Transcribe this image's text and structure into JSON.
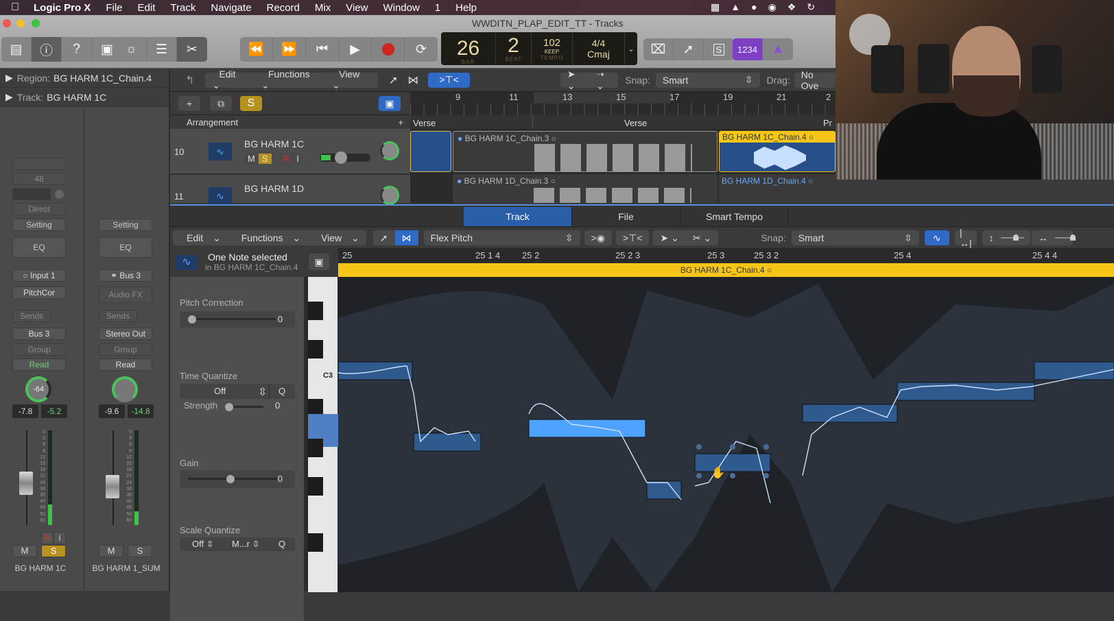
{
  "menubar": {
    "app": "Logic Pro X",
    "items": [
      "File",
      "Edit",
      "Track",
      "Navigate",
      "Record",
      "Mix",
      "View",
      "Window",
      "1",
      "Help"
    ]
  },
  "window": {
    "title": "WWDITN_PLAP_EDIT_TT - Tracks"
  },
  "lcd": {
    "bar": "26",
    "beat": "2",
    "bar_label": "BAR",
    "beat_label": "BEAT",
    "tempo": "102",
    "tempo_mode": "KEEP",
    "tempo_label": "TEMPO",
    "signature": "4/4",
    "key": "Cmaj"
  },
  "toolbar": {
    "count_in": "1234"
  },
  "inspector": {
    "region_label": "Region:",
    "region_name": "BG HARM 1C_Chain.4",
    "track_label": "Track:",
    "track_name": "BG HARM 1C"
  },
  "strip1": {
    "gain": "48",
    "direct": "Direct",
    "setting": "Setting",
    "eq": "EQ",
    "input": "Input 1",
    "plugin": "PitchCor",
    "sends": "Sends",
    "output": "Bus 3",
    "group": "Group",
    "automation": "Read",
    "pan": "-64",
    "volume": "-7.8",
    "peak": "-5.2",
    "name": "BG HARM 1C",
    "mute": "M",
    "solo": "S",
    "rec": "R",
    "input_mon": "I"
  },
  "strip2": {
    "setting": "Setting",
    "eq": "EQ",
    "input": "Bus 3",
    "plugin": "Audio FX",
    "sends": "Sends",
    "output": "Stereo Out",
    "group": "Group",
    "automation": "Read",
    "volume": "-9.6",
    "peak": "-14.8",
    "name": "BG HARM 1_SUM",
    "mute": "M",
    "solo": "S"
  },
  "meter_scale": [
    "0",
    "3",
    "6",
    "9",
    "12",
    "15",
    "18",
    "21",
    "24",
    "30",
    "35",
    "40",
    "45",
    "50",
    "60"
  ],
  "arrange": {
    "menus": [
      "Edit",
      "Functions",
      "View"
    ],
    "snap_label": "Snap:",
    "snap": "Smart",
    "drag_label": "Drag:",
    "drag": "No Ove",
    "section_header": "Arrangement",
    "markers": [
      "Verse",
      "Verse",
      "Pr"
    ],
    "ruler": [
      "9",
      "11",
      "13",
      "15",
      "17",
      "19",
      "21",
      "2"
    ],
    "tracks": [
      {
        "num": "10",
        "name": "BG HARM 1C",
        "m": "M",
        "s": "S",
        "r": "R",
        "i": "I"
      },
      {
        "num": "11",
        "name": "BG HARM 1D"
      }
    ],
    "regions": [
      "BG HARM 1C_Chain.3",
      "BG HARM 1C_Chain.4",
      "BG HARM 1D_Chain.3",
      "BG HARM 1D_Chain.4"
    ]
  },
  "editor": {
    "tabs": [
      "Track",
      "File",
      "Smart Tempo"
    ],
    "menus": [
      "Edit",
      "Functions",
      "View"
    ],
    "mode": "Flex Pitch",
    "snap_label": "Snap:",
    "snap": "Smart",
    "selection": "One Note selected",
    "selection_sub": "in BG HARM 1C_Chain.4",
    "ruler": [
      "25",
      "25 1 4",
      "25 2",
      "25 2 3",
      "25 3",
      "25 3 2",
      "25 4",
      "25 4 4"
    ],
    "region": "BG HARM 1C_Chain.4",
    "pitch_label": "C3",
    "pitch_correction": {
      "label": "Pitch Correction",
      "value": "0"
    },
    "time_quantize": {
      "label": "Time Quantize",
      "value": "Off",
      "q": "Q",
      "strength_label": "Strength",
      "strength": "0"
    },
    "gain": {
      "label": "Gain",
      "value": "0"
    },
    "scale_quantize": {
      "label": "Scale Quantize",
      "value": "Off",
      "scale": "M...r",
      "q": "Q"
    }
  }
}
